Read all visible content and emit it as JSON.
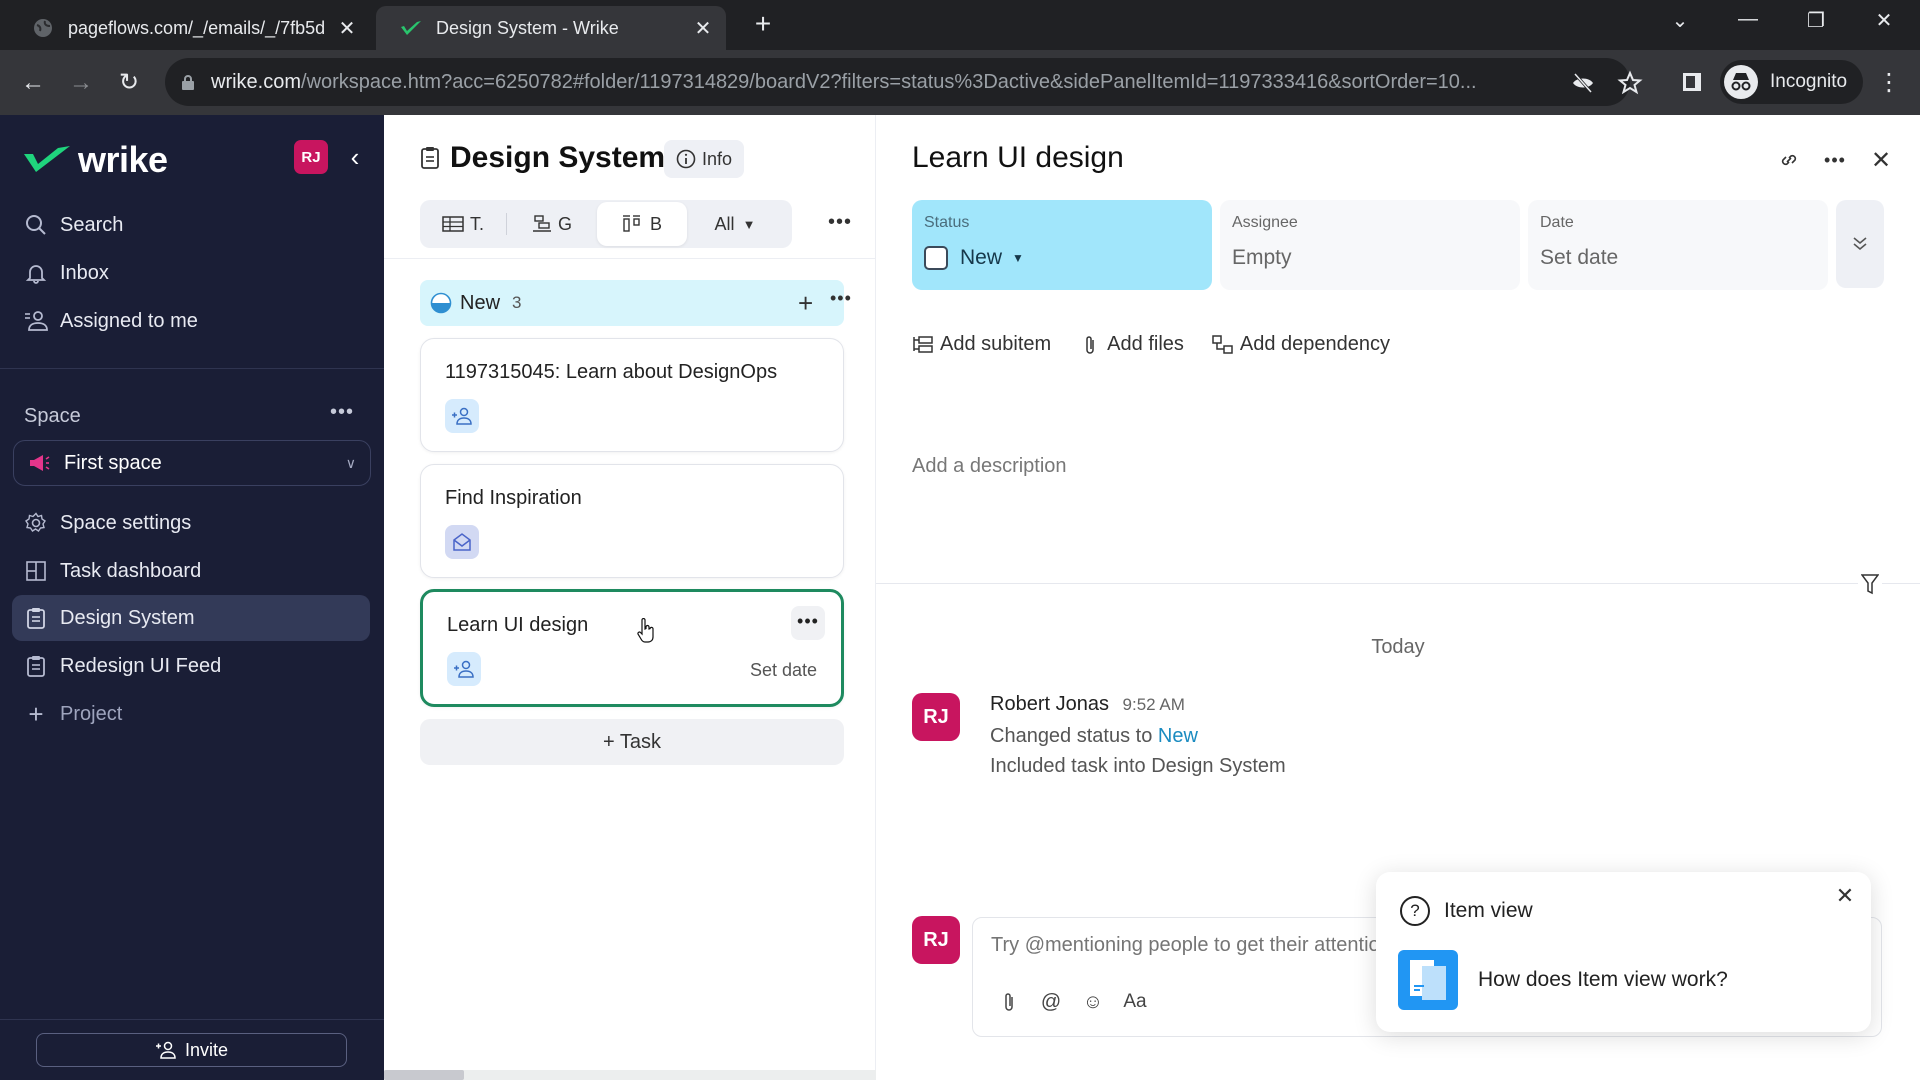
{
  "browser": {
    "tabs": [
      {
        "title": "pageflows.com/_/emails/_/7fb5d",
        "active": false
      },
      {
        "title": "Design System - Wrike",
        "active": true
      }
    ],
    "url_host": "wrike.com",
    "url_path": "/workspace.htm?acc=6250782#folder/1197314829/boardV2?filters=status%3Dactive&sidePanelItemId=1197333416&sortOrder=10...",
    "profile_label": "Incognito"
  },
  "sidebar": {
    "logo": "wrike",
    "avatar_initials": "RJ",
    "nav": [
      {
        "label": "Search",
        "icon": "search-icon"
      },
      {
        "label": "Inbox",
        "icon": "bell-icon"
      },
      {
        "label": "Assigned to me",
        "icon": "assigned-user-icon"
      }
    ],
    "space_label": "Space",
    "space_selected": "First space",
    "space_items": [
      {
        "label": "Space settings",
        "icon": "gear-icon",
        "selected": false
      },
      {
        "label": "Task dashboard",
        "icon": "dashboard-icon",
        "selected": false
      },
      {
        "label": "Design System",
        "icon": "clipboard-icon",
        "selected": true
      },
      {
        "label": "Redesign UI Feed",
        "icon": "clipboard-icon",
        "selected": false
      },
      {
        "label": "Project",
        "icon": "plus-icon",
        "selected": false
      }
    ],
    "invite_label": "Invite"
  },
  "board": {
    "title": "Design System",
    "info_label": "Info",
    "views": [
      {
        "label": "T.",
        "icon": "table-icon",
        "active": false
      },
      {
        "label": "G",
        "icon": "gantt-icon",
        "active": false
      },
      {
        "label": "B",
        "icon": "board-icon",
        "active": true
      }
    ],
    "filter_selected": "All",
    "column": {
      "name": "New",
      "count": "3"
    },
    "cards": [
      {
        "title": "1197315045: Learn about DesignOps",
        "badge": "add-assignee",
        "date": "",
        "selected": false
      },
      {
        "title": "Find Inspiration",
        "badge": "email",
        "date": "",
        "selected": false
      },
      {
        "title": "Learn UI design",
        "badge": "add-assignee",
        "date": "Set date",
        "selected": true
      }
    ],
    "add_task_label": "+ Task"
  },
  "panel": {
    "title": "Learn UI design",
    "status": {
      "label": "Status",
      "value": "New",
      "color": "#a1e6fb"
    },
    "assignee": {
      "label": "Assignee",
      "value": "Empty"
    },
    "date": {
      "label": "Date",
      "value": "Set date"
    },
    "actions": [
      "Add subitem",
      "Add files",
      "Add dependency"
    ],
    "description_placeholder": "Add a description",
    "stream_date": "Today",
    "activity": {
      "author": "Robert Jonas",
      "initials": "RJ",
      "time": "9:52 AM",
      "line1_prefix": "Changed status to ",
      "line1_link": "New",
      "line2": "Included task into Design System"
    },
    "comment_placeholder": "Try @mentioning people to get their attention",
    "comment_tools": [
      "Aa"
    ]
  },
  "popup": {
    "title": "Item view",
    "link_label": "How does Item view work?"
  }
}
